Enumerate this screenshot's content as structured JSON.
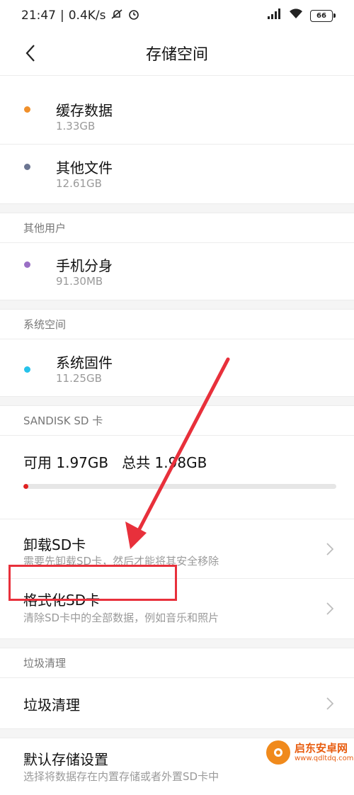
{
  "status_bar": {
    "time": "21:47",
    "net_speed": "0.4K/s",
    "battery": "66"
  },
  "header": {
    "title": "存储空间"
  },
  "storage_items": [
    {
      "title": "缓存数据",
      "size": "1.33GB",
      "color": "#f0902b"
    },
    {
      "title": "其他文件",
      "size": "12.61GB",
      "color": "#6b7591"
    }
  ],
  "other_users": {
    "header": "其他用户",
    "items": [
      {
        "title": "手机分身",
        "size": "91.30MB",
        "color": "#9a6fc5"
      }
    ]
  },
  "system_space": {
    "header": "系统空间",
    "items": [
      {
        "title": "系统固件",
        "size": "11.25GB",
        "color": "#26c2ea"
      }
    ]
  },
  "sd_card": {
    "header": "SANDISK SD 卡",
    "usage_text": "可用 1.97GB   总共 1.98GB",
    "usage_fraction": 0.015,
    "unmount": {
      "title": "卸载SD卡",
      "subtitle": "需要先卸载SD卡，然后才能将其安全移除"
    },
    "format": {
      "title": "格式化SD卡",
      "subtitle": "清除SD卡中的全部数据，例如音乐和照片"
    }
  },
  "junk": {
    "header": "垃圾清理",
    "item": "垃圾清理"
  },
  "default_storage": {
    "title": "默认存储设置",
    "subtitle": "选择将数据存在内置存储或者外置SD卡中"
  },
  "watermark": {
    "name": "启东安卓网",
    "url": "www.qdltdq.com"
  },
  "colors": {
    "accent_red": "#e8303b",
    "usage_bar_fill": "#e02020"
  }
}
